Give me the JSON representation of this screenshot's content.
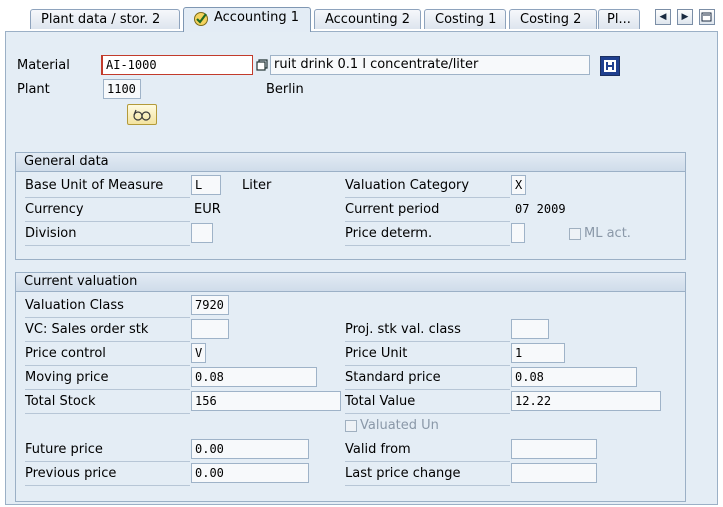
{
  "tabs": [
    "Plant data / stor. 2",
    "Accounting 1",
    "Accounting 2",
    "Costing 1",
    "Costing 2",
    "Pl..."
  ],
  "header": {
    "material_label": "Material",
    "material_value": "AI-1000",
    "material_desc": "ruit drink 0.1 l concentrate/liter",
    "plant_label": "Plant",
    "plant_value": "1100",
    "plant_name": "Berlin"
  },
  "general": {
    "title": "General data",
    "base_uom_label": "Base Unit of Measure",
    "base_uom_value": "L",
    "base_uom_text": "Liter",
    "valuation_category_label": "Valuation Category",
    "valuation_category_value": "X",
    "currency_label": "Currency",
    "currency_value": "EUR",
    "current_period_label": "Current period",
    "current_period_value": "07 2009",
    "division_label": "Division",
    "division_value": "",
    "price_determ_label": "Price determ.",
    "price_determ_value": "",
    "ml_act_label": "ML act."
  },
  "valuation": {
    "title": "Current valuation",
    "valuation_class_label": "Valuation Class",
    "valuation_class_value": "7920",
    "vc_sales_label": "VC: Sales order stk",
    "vc_sales_value": "",
    "proj_stk_label": "Proj. stk val. class",
    "proj_stk_value": "",
    "price_control_label": "Price control",
    "price_control_value": "V",
    "price_unit_label": "Price Unit",
    "price_unit_value": "1",
    "moving_price_label": "Moving price",
    "moving_price_value": "0.08",
    "standard_price_label": "Standard price",
    "standard_price_value": "0.08",
    "total_stock_label": "Total Stock",
    "total_stock_value": "156",
    "total_value_label": "Total Value",
    "total_value_value": "12.22",
    "valuated_un_label": "Valuated Un",
    "future_price_label": "Future price",
    "future_price_value": "0.00",
    "valid_from_label": "Valid from",
    "valid_from_value": "",
    "previous_price_label": "Previous price",
    "previous_price_value": "0.00",
    "last_price_change_label": "Last price change",
    "last_price_change_value": ""
  }
}
